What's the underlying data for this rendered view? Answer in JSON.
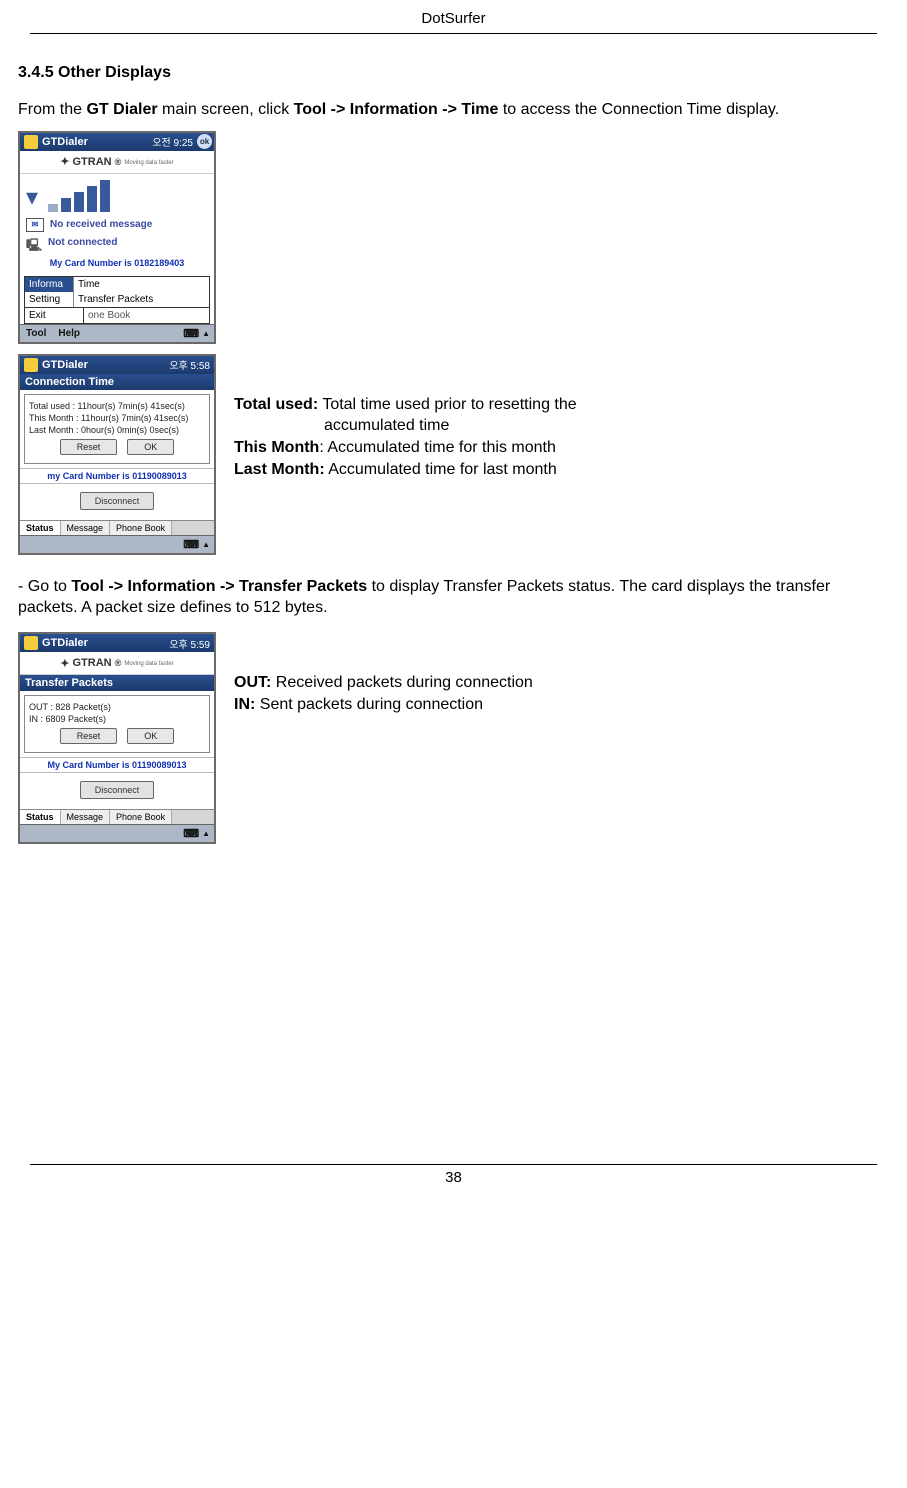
{
  "header": {
    "title": "DotSurfer"
  },
  "section_heading": "3.4.5 Other Displays",
  "para1_pre": "From the ",
  "para1_b1": "GT Dialer",
  "para1_mid": " main screen, click ",
  "para1_b2": "Tool -> Information -> Time",
  "para1_post": " to access the Connection Time display.",
  "shot1": {
    "app": "GTDialer",
    "time": "오전 9:25",
    "ok": "ok",
    "brand": "GTRAN",
    "brand_tag": "Moving data faster",
    "msg_line": "No received message",
    "conn_line": "Not connected",
    "card": "My Card Number is 0182189403",
    "menu_informa": "Informa",
    "menu_setting": "Setting",
    "menu_time": "Time",
    "menu_transfer": "Transfer Packets",
    "menu_exit": "Exit",
    "menu_rest": "one Book",
    "bb_tool": "Tool",
    "bb_help": "Help"
  },
  "shot2": {
    "app": "GTDialer",
    "time": "오후 5:58",
    "panel_title": "Connection Time",
    "line1": "Total used : 11hour(s) 7min(s) 41sec(s)",
    "line2": "This Month : 11hour(s) 7min(s) 41sec(s)",
    "line3": "Last Month : 0hour(s) 0min(s) 0sec(s)",
    "btn_reset": "Reset",
    "btn_ok": "OK",
    "card": "my Card Number is 01190089013",
    "btn_disc": "Disconnect",
    "tab_status": "Status",
    "tab_message": "Message",
    "tab_phone": "Phone Book"
  },
  "defs1": {
    "l1a": "Total used:",
    "l1b": " Total time used prior to resetting the",
    "l1c": "accumulated time",
    "l2a": "This Month",
    "l2b": ": Accumulated time for this month",
    "l3a": "Last Month:",
    "l3b": " Accumulated time for last month"
  },
  "para2_pre": "- Go to ",
  "para2_b": "Tool -> Information -> Transfer Packets",
  "para2_post": " to display Transfer Packets status. The card displays the transfer packets. A packet size defines to 512 bytes.",
  "shot3": {
    "app": "GTDialer",
    "time": "오후 5:59",
    "brand": "GTRAN",
    "brand_tag": "Moving data faster",
    "panel_title": "Transfer Packets",
    "line_out": "OUT : 828 Packet(s)",
    "line_in": "IN : 6809 Packet(s)",
    "btn_reset": "Reset",
    "btn_ok": "OK",
    "card": "My Card Number is 01190089013",
    "btn_disc": "Disconnect",
    "tab_status": "Status",
    "tab_message": "Message",
    "tab_phone": "Phone Book"
  },
  "defs2": {
    "l1a": "OUT:",
    "l1b": " Received packets during connection",
    "l2a": "IN:",
    "l2b": " Sent packets during connection"
  },
  "page_number": "38"
}
